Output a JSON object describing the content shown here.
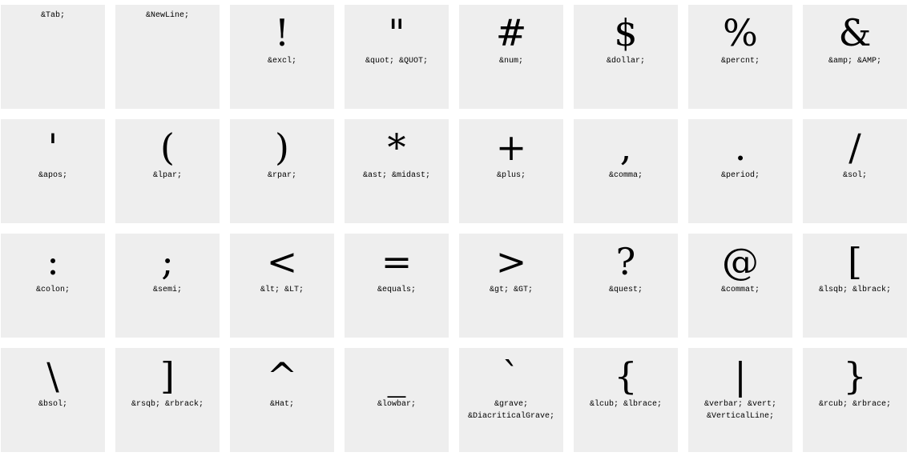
{
  "entities": [
    {
      "glyph": "",
      "names": "&Tab;"
    },
    {
      "glyph": "",
      "names": "&NewLine;"
    },
    {
      "glyph": "!",
      "names": "&excl;"
    },
    {
      "glyph": "\"",
      "names": "&quot; &QUOT;"
    },
    {
      "glyph": "#",
      "names": "&num;"
    },
    {
      "glyph": "$",
      "names": "&dollar;"
    },
    {
      "glyph": "%",
      "names": "&percnt;"
    },
    {
      "glyph": "&",
      "names": "&amp; &AMP;"
    },
    {
      "glyph": "'",
      "names": "&apos;"
    },
    {
      "glyph": "(",
      "names": "&lpar;"
    },
    {
      "glyph": ")",
      "names": "&rpar;"
    },
    {
      "glyph": "*",
      "names": "&ast; &midast;"
    },
    {
      "glyph": "+",
      "names": "&plus;"
    },
    {
      "glyph": ",",
      "names": "&comma;"
    },
    {
      "glyph": ".",
      "names": "&period;"
    },
    {
      "glyph": "/",
      "names": "&sol;"
    },
    {
      "glyph": ":",
      "names": "&colon;"
    },
    {
      "glyph": ";",
      "names": "&semi;"
    },
    {
      "glyph": "<",
      "names": "&lt; &LT;"
    },
    {
      "glyph": "=",
      "names": "&equals;"
    },
    {
      "glyph": ">",
      "names": "&gt; &GT;"
    },
    {
      "glyph": "?",
      "names": "&quest;"
    },
    {
      "glyph": "@",
      "names": "&commat;"
    },
    {
      "glyph": "[",
      "names": "&lsqb; &lbrack;"
    },
    {
      "glyph": "\\",
      "names": "&bsol;"
    },
    {
      "glyph": "]",
      "names": "&rsqb; &rbrack;"
    },
    {
      "glyph": "^",
      "names": "&Hat;"
    },
    {
      "glyph": "_",
      "names": "&lowbar;"
    },
    {
      "glyph": "`",
      "names": "&grave; &DiacriticalGrave;"
    },
    {
      "glyph": "{",
      "names": "&lcub; &lbrace;"
    },
    {
      "glyph": "|",
      "names": "&verbar; &vert; &VerticalLine;"
    },
    {
      "glyph": "}",
      "names": "&rcub; &rbrace;"
    }
  ]
}
